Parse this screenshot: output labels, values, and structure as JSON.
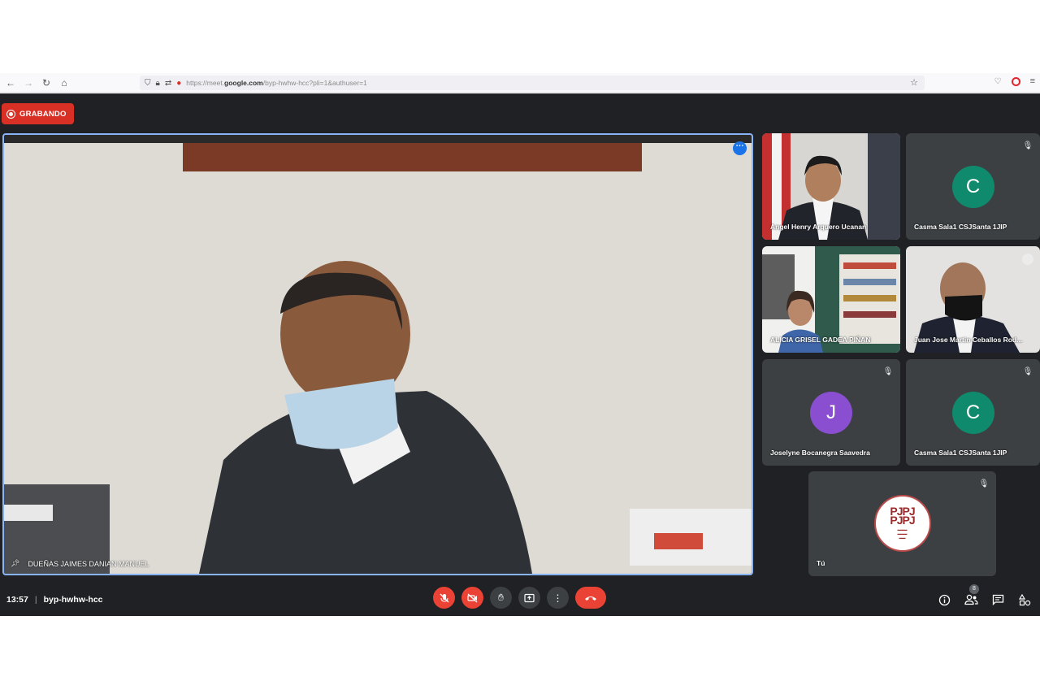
{
  "browser": {
    "url_prefix": "https://meet.",
    "url_domain": "google.com",
    "url_path": "/byp-hwhw-hcc?pli=1&authuser=1"
  },
  "recording_badge": {
    "label": "GRABANDO"
  },
  "main_participant": {
    "name": "DUEÑAS JAIMES DANIAN MANUEL"
  },
  "participants": [
    {
      "name": "Angel Henry Arquero Ucanan",
      "type": "video"
    },
    {
      "name": "Casma Sala1 CSJSanta 1JIP",
      "type": "avatar",
      "initial": "C",
      "avatar_color": "#0f8a6d"
    },
    {
      "name": "ALICIA GRISEL GADEA PIÑAN",
      "type": "video"
    },
    {
      "name": "Juan Jose Martin Ceballos Rod...",
      "type": "video"
    },
    {
      "name": "Joselyne Bocanegra Saavedra",
      "type": "avatar",
      "initial": "J",
      "avatar_color": "#8a4fd1"
    },
    {
      "name": "Casma Sala1 CSJSanta 1JIP",
      "type": "avatar",
      "initial": "C",
      "avatar_color": "#0f8a6d"
    }
  ],
  "self_tile": {
    "name": "Tú",
    "logo_text": "PJPJ"
  },
  "bottom_bar": {
    "time": "13:57",
    "meeting_code": "byp-hwhw-hcc",
    "participant_count": "8"
  },
  "colors": {
    "meet_bg": "#202124",
    "tile_bg": "#3c4043",
    "end_call": "#ea4335",
    "active_border": "#8ab4f8"
  },
  "icons": [
    "back-icon",
    "forward-icon",
    "reload-icon",
    "home-icon",
    "shield-icon",
    "lock-icon",
    "permissions-icon",
    "mic-indicator-icon",
    "bookmark-star-icon",
    "pocket-icon",
    "opera-icon",
    "menu-icon",
    "mic-off-icon",
    "camera-off-icon",
    "raise-hand-icon",
    "present-icon",
    "more-options-icon",
    "end-call-icon",
    "info-icon",
    "people-icon",
    "chat-icon",
    "activities-icon",
    "pin-icon"
  ]
}
